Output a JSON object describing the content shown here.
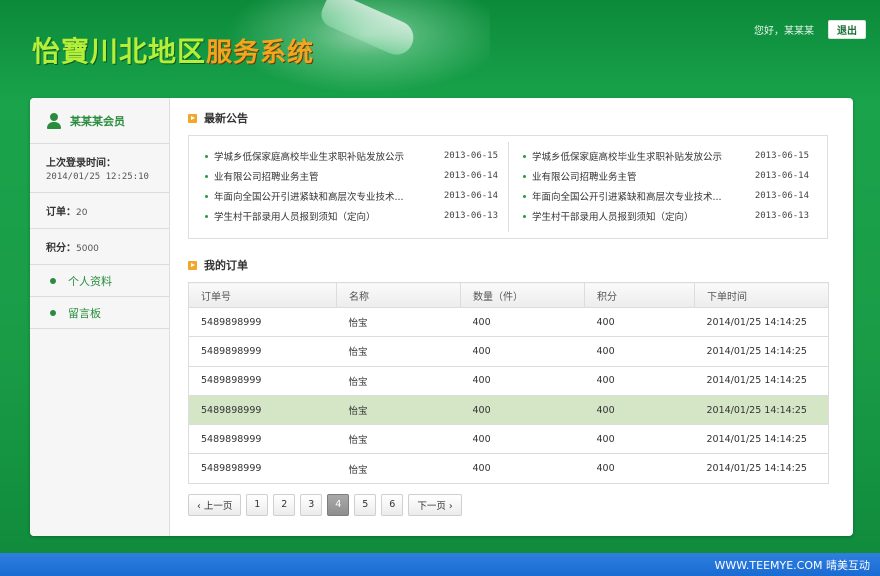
{
  "header": {
    "logo_part1": "怡寶川北地区",
    "logo_part2": "服务系统",
    "greeting": "您好，某某某",
    "logout_label": "退出"
  },
  "sidebar": {
    "member_name": "某某某会员",
    "last_login_label": "上次登录时间：",
    "last_login_value": "2014/01/25 12:25:10",
    "orders_label": "订单：",
    "orders_value": "20",
    "points_label": "积分：",
    "points_value": "5000",
    "links": [
      {
        "label": "个人资料"
      },
      {
        "label": "留言板"
      }
    ]
  },
  "notices": {
    "title": "最新公告",
    "left": [
      {
        "title": "学城乡低保家庭高校毕业生求职补贴发放公示",
        "date": "2013-06-15"
      },
      {
        "title": "业有限公司招聘业务主管",
        "date": "2013-06-14"
      },
      {
        "title": "年面向全国公开引进紧缺和高层次专业技术...",
        "date": "2013-06-14"
      },
      {
        "title": "学生村干部录用人员报到须知（定向）",
        "date": "2013-06-13"
      }
    ],
    "right": [
      {
        "title": "学城乡低保家庭高校毕业生求职补贴发放公示",
        "date": "2013-06-15"
      },
      {
        "title": "业有限公司招聘业务主管",
        "date": "2013-06-14"
      },
      {
        "title": "年面向全国公开引进紧缺和高层次专业技术...",
        "date": "2013-06-14"
      },
      {
        "title": "学生村干部录用人员报到须知（定向）",
        "date": "2013-06-13"
      }
    ]
  },
  "orders": {
    "title": "我的订单",
    "columns": [
      "订单号",
      "名称",
      "数量（件）",
      "积分",
      "下单时间"
    ],
    "rows": [
      [
        "5489898999",
        "怡宝",
        "400",
        "400",
        "2014/01/25   14:14:25"
      ],
      [
        "5489898999",
        "怡宝",
        "400",
        "400",
        "2014/01/25   14:14:25"
      ],
      [
        "5489898999",
        "怡宝",
        "400",
        "400",
        "2014/01/25   14:14:25"
      ],
      [
        "5489898999",
        "怡宝",
        "400",
        "400",
        "2014/01/25   14:14:25"
      ],
      [
        "5489898999",
        "怡宝",
        "400",
        "400",
        "2014/01/25   14:14:25"
      ],
      [
        "5489898999",
        "怡宝",
        "400",
        "400",
        "2014/01/25   14:14:25"
      ]
    ],
    "selected_row": 3
  },
  "pager": {
    "prev_label": "‹ 上一页",
    "pages": [
      "1",
      "2",
      "3",
      "4",
      "5",
      "6"
    ],
    "current_page": "4",
    "next_label": "下一页 ›"
  },
  "footer": {
    "text": "WWW.TEEMYE.COM  晴美互动"
  },
  "colors": {
    "brand_green": "#1a9c47",
    "accent_orange": "#f2a61f",
    "selected_row": "#d5e6c7",
    "footer_blue": "#2f7fe0"
  }
}
